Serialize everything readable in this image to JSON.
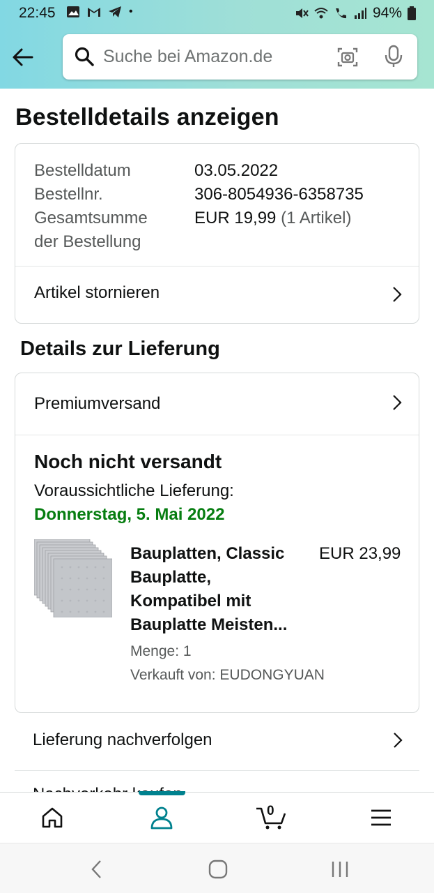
{
  "status_bar": {
    "time": "22:45",
    "dot": "•",
    "battery": "94%",
    "icons": [
      "image-icon",
      "gmail-icon",
      "telegram-icon",
      "mute-icon",
      "wifi-icon",
      "wifi-call-icon",
      "signal-icon",
      "battery-icon"
    ]
  },
  "search": {
    "placeholder": "Suche bei Amazon.de"
  },
  "page": {
    "title": "Bestelldetails anzeigen"
  },
  "order_summary": {
    "rows": [
      {
        "label": "Bestelldatum",
        "value": "03.05.2022"
      },
      {
        "label": "Bestellnr.",
        "value": "306-8054936-6358735"
      },
      {
        "label": "Gesamtsumme",
        "label2": "der Bestellung",
        "value": "EUR 19,99",
        "value_extra": "(1 Artikel)"
      }
    ],
    "cancel_label": "Artikel stornieren"
  },
  "delivery": {
    "section_title": "Details zur Lieferung",
    "shipping_method": "Premiumversand",
    "status": "Noch nicht versandt",
    "eta_label": "Voraussichtliche Lieferung:",
    "eta_date": "Donnerstag, 5. Mai 2022",
    "item": {
      "title": "Bauplatten, Classic Bauplatte, Kompatibel mit Bauplatte Meisten...",
      "price": "EUR 23,99",
      "quantity": "Menge: 1",
      "seller": "Verkauft von: EUDONGYUAN"
    },
    "track_label": "Lieferung nachverfolgen",
    "next_row_peek": "Nachverkehr kaufen"
  },
  "bottom_nav": {
    "items": [
      "home-icon",
      "account-icon",
      "cart-icon",
      "menu-icon"
    ],
    "cart_count": "0",
    "active": "account",
    "accent_color": "#00818e"
  },
  "colors": {
    "header_gradient_start": "#82d8e3",
    "header_gradient_end": "#a6e5d2",
    "delivery_green": "#067d10",
    "muted_text": "#565959"
  }
}
